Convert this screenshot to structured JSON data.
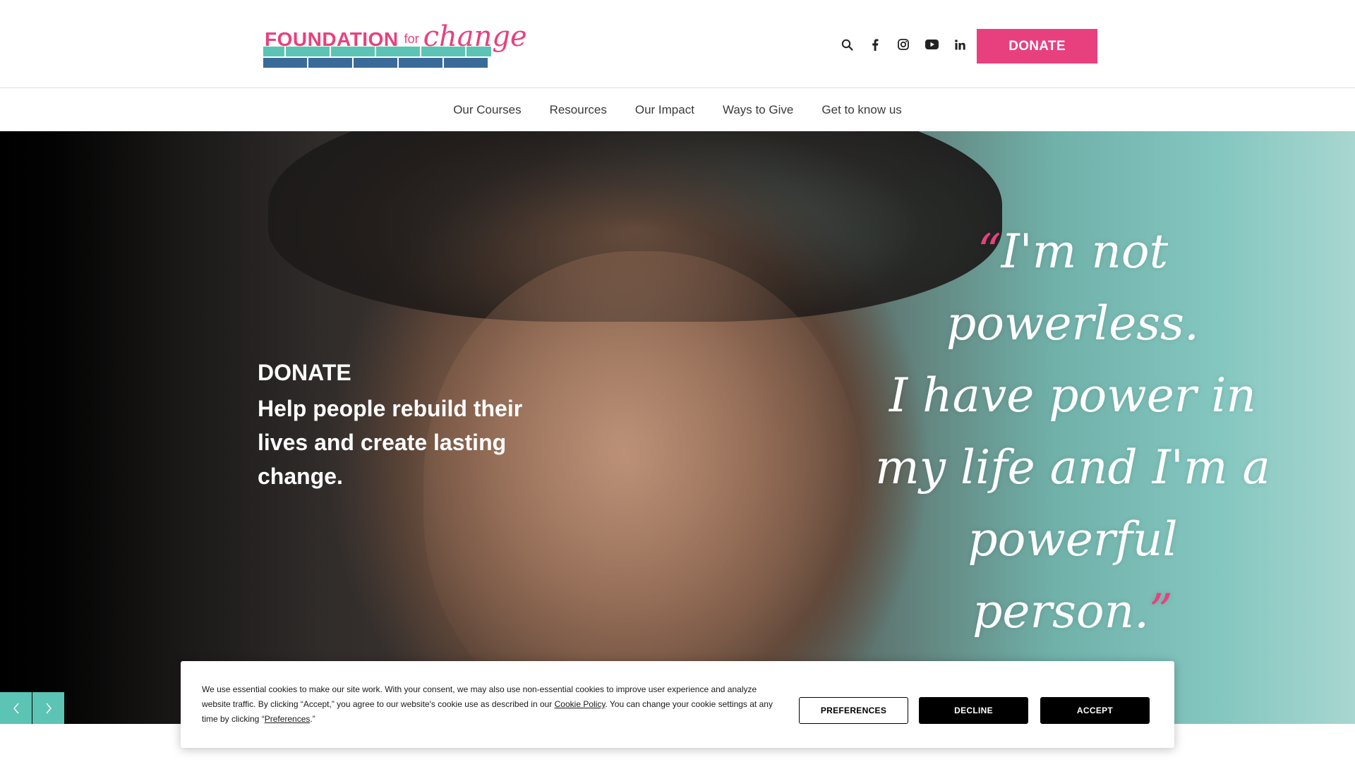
{
  "header": {
    "logo": {
      "word1": "FOUNDATION",
      "word2": "for",
      "word3": "change"
    },
    "social_icons": [
      "search-icon",
      "facebook-icon",
      "instagram-icon",
      "youtube-icon",
      "linkedin-icon"
    ],
    "donate_label": "DONATE"
  },
  "nav": {
    "items": [
      "Our Courses",
      "Resources",
      "Our Impact",
      "Ways to Give",
      "Get to know us"
    ]
  },
  "hero": {
    "kicker": "DONATE",
    "title": "Help people rebuild their lives and create lasting change.",
    "quote": {
      "open_mark": "“",
      "line1": "I'm not",
      "line2": "powerless.",
      "line3": "I have power in",
      "line4": "my life and I'm a",
      "line5": "powerful",
      "line6": "person.",
      "close_mark": "”"
    },
    "arrows": [
      "chevron-left-icon",
      "chevron-right-icon"
    ]
  },
  "cookie_banner": {
    "text_before_policy": "We use essential cookies to make our site work. With your consent, we may also use non-essential cookies to improve user experience and analyze website traffic. By clicking “Accept,” you agree to our website's cookie use as described in our ",
    "policy_link": "Cookie Policy",
    "text_after_policy": ". You can change your cookie settings at any time by clicking “",
    "preferences_link": "Preferences",
    "text_end": ".”",
    "preferences_label": "PREFERENCES",
    "decline_label": "DECLINE",
    "accept_label": "ACCEPT"
  },
  "colors": {
    "brand_pink": "#e8407e",
    "brand_teal": "#5cc4b4",
    "brand_blue": "#3a6a99"
  }
}
